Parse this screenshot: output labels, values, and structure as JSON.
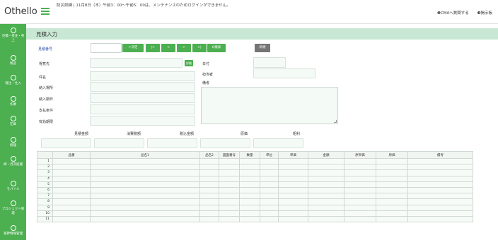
{
  "topbar": {
    "brand": "Othello",
    "notice": "防災訓練 | 11月8日（木）午前3：00〜午前5：00は、メンテナンスのためログインができません。",
    "links": [
      "❷CMAへ質問する",
      "❸掲示板"
    ]
  },
  "sidebar": {
    "items": [
      {
        "label": "見積・受注・売上"
      },
      {
        "label": "製造"
      },
      {
        "label": "発注・仕入"
      },
      {
        "label": "作業"
      },
      {
        "label": "在庫"
      },
      {
        "label": "経理"
      },
      {
        "label": "締・月次処理"
      },
      {
        "label": "モバイル"
      },
      {
        "label": "プロジェクト管理"
      },
      {
        "label": "基幹情報管理"
      }
    ]
  },
  "page": {
    "title": "見積入力"
  },
  "form": {
    "quote_no_label": "見積番号",
    "quote_no_value": "",
    "buttons": {
      "decide": "✔決定",
      "first": "|<",
      "prev": "<",
      "next": ">",
      "last": ">|",
      "search": "Q検索",
      "new": "新規"
    },
    "customer_label": "得意先",
    "detail_button": "詳細",
    "subject_label": "件名",
    "delivery_place_label": "納入場所",
    "delivery_date_label": "納入期日",
    "payment_terms_label": "支払条件",
    "valid_until_label": "有効期限",
    "date_label": "日付",
    "person_label": "担当者",
    "remarks_label": "備考"
  },
  "summary": {
    "labels": [
      "見積金額",
      "消費税額",
      "税込金額",
      "原価",
      "粗利"
    ]
  },
  "grid": {
    "columns": [
      "",
      "品番",
      "品名1",
      "品名2",
      "図面番号",
      "数量",
      "単位",
      "単価",
      "金額",
      "原単価",
      "原価",
      "備考"
    ],
    "rows": [
      "1",
      "2",
      "3",
      "4",
      "5",
      "6",
      "7",
      "8",
      "9",
      "10",
      "11"
    ]
  }
}
